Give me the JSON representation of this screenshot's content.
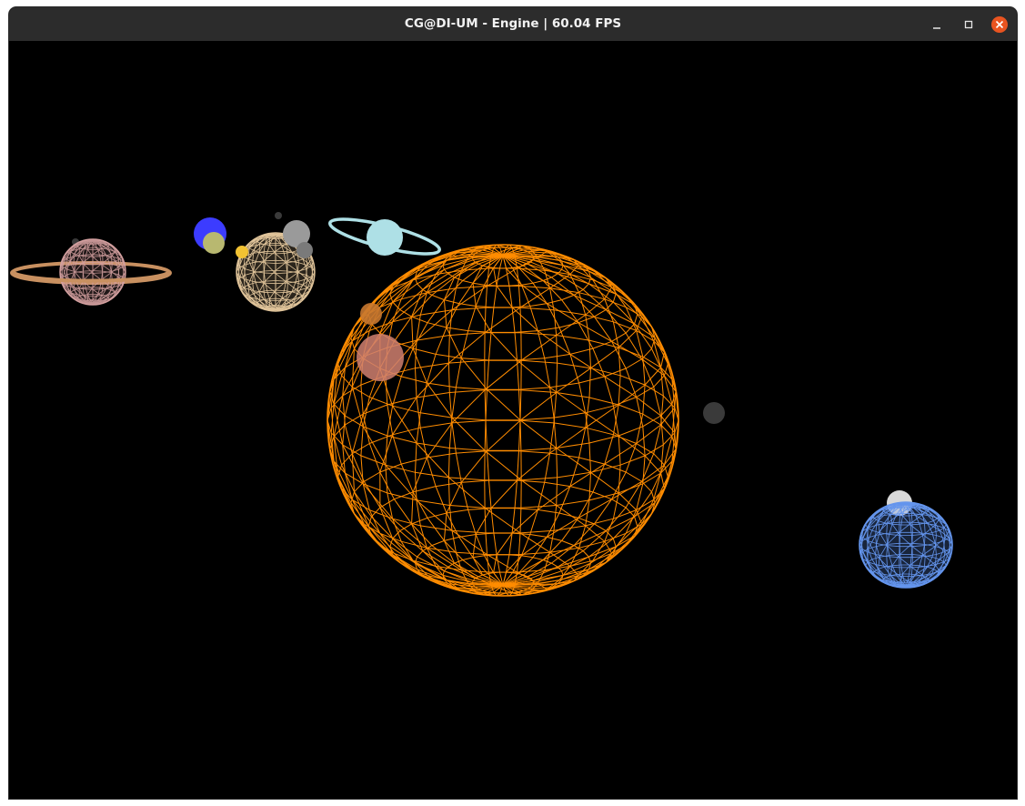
{
  "window": {
    "title": "CG@DI-UM - Engine | 60.04 FPS",
    "controls": [
      {
        "name": "minimize",
        "icon": "minimize-icon"
      },
      {
        "name": "maximize",
        "icon": "maximize-icon"
      },
      {
        "name": "close",
        "icon": "close-icon",
        "color": "#e95420"
      }
    ]
  },
  "scene": {
    "background": "#000000",
    "render_mode": "wireframe",
    "bodies": [
      {
        "name": "sun",
        "color": "#ff8c00",
        "style": "wireframe"
      },
      {
        "name": "ringed-planet-pink",
        "color": "#d4a0a0",
        "ring_color": "#c89060",
        "style": "wireframe"
      },
      {
        "name": "blue-planet",
        "color": "#3c3cff",
        "style": "solid"
      },
      {
        "name": "olive-moon",
        "color": "#b8b870",
        "style": "solid"
      },
      {
        "name": "tan-planet",
        "color": "#d8b88c",
        "style": "wireframe"
      },
      {
        "name": "grey-moon",
        "color": "#9a9a9a",
        "style": "solid"
      },
      {
        "name": "yellow-moon",
        "color": "#f2c232",
        "style": "solid"
      },
      {
        "name": "ringed-planet-cyan",
        "color": "#aee0e6",
        "ring_color": "#aee0e6",
        "style": "solid"
      },
      {
        "name": "orange-moon",
        "color": "#c87830",
        "style": "solid"
      },
      {
        "name": "salmon-planet",
        "color": "#d08070",
        "style": "solid"
      },
      {
        "name": "dark-grey-planet",
        "color": "#3a3a3a",
        "style": "solid"
      },
      {
        "name": "cornflower-planet",
        "color": "#6495ed",
        "style": "wireframe"
      },
      {
        "name": "white-moon",
        "color": "#d8d8d8",
        "style": "solid"
      }
    ]
  }
}
